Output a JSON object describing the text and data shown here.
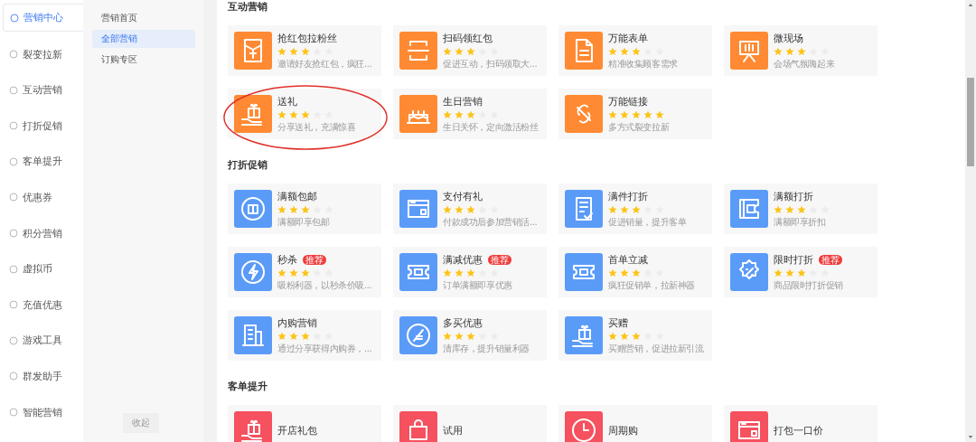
{
  "sidebar": {
    "items": [
      {
        "label": "营销中心",
        "selected": true
      },
      {
        "label": "裂变拉新",
        "selected": false
      },
      {
        "label": "互动营销",
        "selected": false
      },
      {
        "label": "打折促销",
        "selected": false
      },
      {
        "label": "客单提升",
        "selected": false
      },
      {
        "label": "优惠券",
        "selected": false
      },
      {
        "label": "积分营销",
        "selected": false
      },
      {
        "label": "虚拟币",
        "selected": false
      },
      {
        "label": "充值优惠",
        "selected": false
      },
      {
        "label": "游戏工具",
        "selected": false
      },
      {
        "label": "群发助手",
        "selected": false
      },
      {
        "label": "智能营销",
        "selected": false
      }
    ]
  },
  "submenu": {
    "items": [
      {
        "label": "营销首页",
        "selected": false
      },
      {
        "label": "全部营销",
        "selected": true
      },
      {
        "label": "订购专区",
        "selected": false
      }
    ],
    "collapse_button": "收起"
  },
  "sections": [
    {
      "title": "互动营销",
      "color": "#ff8a33",
      "cards": [
        {
          "title": "抢红包拉粉丝",
          "stars": 3,
          "description": "邀请好友抢红包，疯狂..."
        },
        {
          "title": "扫码领红包",
          "stars": 3,
          "description": "促进互动，扫码领取大..."
        },
        {
          "title": "万能表单",
          "stars": 3,
          "description": "精准收集顾客需求"
        },
        {
          "title": "微现场",
          "stars": 3,
          "description": "会场气氛嗨起来"
        },
        {
          "title": "送礼",
          "stars": 3,
          "description": "分享送礼，充满惊喜",
          "circled": true
        },
        {
          "title": "生日营销",
          "stars": 3,
          "description": "生日关怀，定向激活粉丝"
        },
        {
          "title": "万能链接",
          "stars": 5,
          "description": "多方式裂变拉新"
        }
      ]
    },
    {
      "title": "打折促销",
      "color": "#5b9bf8",
      "cards": [
        {
          "title": "满额包邮",
          "stars": 3,
          "description": "满额即享包邮"
        },
        {
          "title": "支付有礼",
          "stars": 3,
          "description": "付款成功后参加营销活..."
        },
        {
          "title": "满件打折",
          "stars": 3,
          "description": "促进销量，提升客单"
        },
        {
          "title": "满额打折",
          "stars": 3,
          "description": "满额即享折扣"
        },
        {
          "title": "秒杀",
          "badge": "推荐",
          "stars": 3,
          "description": "吸粉利器，以秒杀价吸..."
        },
        {
          "title": "满减优惠",
          "badge": "推荐",
          "stars": 3,
          "description": "订单满额即享优惠"
        },
        {
          "title": "首单立减",
          "stars": 3,
          "description": "疯狂促销单，拉新神器"
        },
        {
          "title": "限时打折",
          "badge": "推荐",
          "stars": 3,
          "description": "商品限时打折促销"
        },
        {
          "title": "内购营销",
          "stars": 3,
          "description": "通过分享获得内购券，..."
        },
        {
          "title": "多买优惠",
          "stars": 3,
          "description": "清库存，提升销量利器"
        },
        {
          "title": "买赠",
          "stars": 3,
          "description": "买赠营销，促进拉新引流"
        }
      ]
    },
    {
      "title": "客单提升",
      "color": "#f5515f",
      "cards": [
        {
          "title": "开店礼包"
        },
        {
          "title": "试用"
        },
        {
          "title": "周期购"
        },
        {
          "title": "打包一口价"
        }
      ]
    }
  ]
}
